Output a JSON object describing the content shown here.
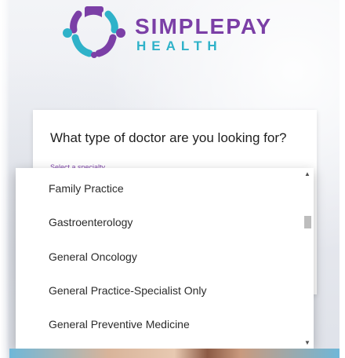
{
  "brand": {
    "name_top": "SIMPLEPAY",
    "name_bottom": "HEALTH",
    "colors": {
      "purple": "#7b3fa6",
      "teal": "#2fb2c9"
    }
  },
  "search_card": {
    "title": "What type of doctor are you looking for?",
    "field_label": "Select a specialty"
  },
  "specialty_dropdown": {
    "options": [
      "Family Practice",
      "Gastroenterology",
      "General Oncology",
      "General Practice-Specialist Only",
      "General Preventive Medicine"
    ],
    "scroll_position": 0.25
  },
  "icons": {
    "scroll_up": "scroll-up-arrow-icon",
    "scroll_down": "scroll-down-arrow-icon"
  }
}
